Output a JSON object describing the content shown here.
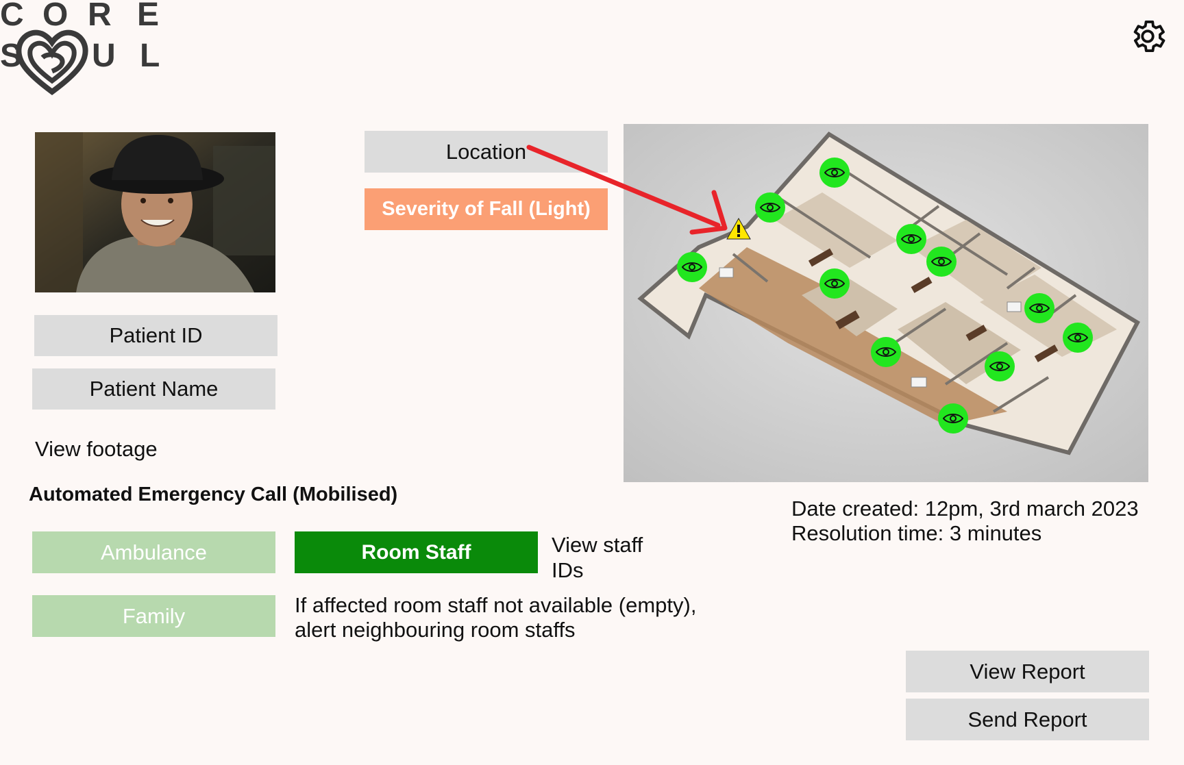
{
  "logo": {
    "letters": [
      "C",
      "O",
      "R",
      "E",
      "S",
      "U",
      "L"
    ]
  },
  "header": {
    "settings_icon": "gear-icon"
  },
  "patient": {
    "photo_icon": "patient-photo",
    "id_label": "Patient ID",
    "name_label": "Patient Name",
    "view_footage": "View footage"
  },
  "incident": {
    "location_label": "Location",
    "severity_label": "Severity of Fall (Light)",
    "severity_color": "#fb9f74"
  },
  "map": {
    "alert_icon": "warning-icon",
    "camera_icon": "eye-icon",
    "camera_color": "#22e61f",
    "arrow_color": "#e8242a"
  },
  "emergency": {
    "title": "Automated Emergency Call (Mobilised)",
    "ambulance": "Ambulance",
    "family": "Family",
    "room_staff": "Room Staff",
    "inactive_color": "#b7d9ae",
    "active_color": "#0a8a0a",
    "view_staff_ids": "View staff IDs",
    "note_line1": "If affected room staff not available (empty),",
    "note_line2": "alert neighbouring room staffs"
  },
  "details": {
    "date_created": "Date created: 12pm, 3rd march 2023",
    "resolution_time": "Resolution time: 3 minutes"
  },
  "actions": {
    "view_report": "View Report",
    "send_report": "Send Report"
  }
}
